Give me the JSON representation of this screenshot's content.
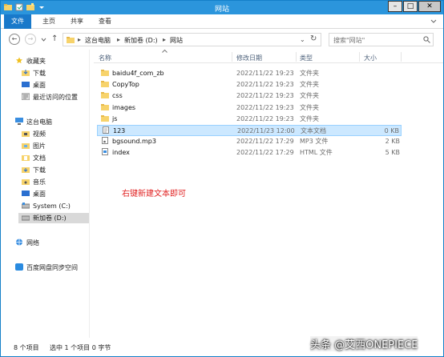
{
  "window": {
    "title": "网站",
    "minimize": "–",
    "maximize": "□",
    "close": "✕"
  },
  "ribbon": {
    "tabs": [
      "文件",
      "主页",
      "共享",
      "查看"
    ]
  },
  "address": {
    "crumbs": [
      "这台电脑",
      "新加卷 (D:)",
      "网站"
    ],
    "search_placeholder": "搜索\"网站\""
  },
  "nav": {
    "favorites": "收藏夹",
    "fav_items": [
      "下载",
      "桌面",
      "最近访问的位置"
    ],
    "this_pc": "这台电脑",
    "pc_items": [
      "视频",
      "图片",
      "文档",
      "下载",
      "音乐",
      "桌面",
      "System (C:)",
      "新加卷 (D:)"
    ],
    "network": "网络",
    "baidu": "百度网盘同步空间"
  },
  "columns": {
    "name": "名称",
    "date": "修改日期",
    "type": "类型",
    "size": "大小"
  },
  "files": [
    {
      "name": "baidu4f_com_zb",
      "date": "2022/11/22 19:23",
      "type": "文件夹",
      "size": "",
      "icon": "folder-icon"
    },
    {
      "name": "CopyTop",
      "date": "2022/11/22 19:23",
      "type": "文件夹",
      "size": "",
      "icon": "folder-icon"
    },
    {
      "name": "css",
      "date": "2022/11/22 19:23",
      "type": "文件夹",
      "size": "",
      "icon": "folder-icon"
    },
    {
      "name": "images",
      "date": "2022/11/22 19:23",
      "type": "文件夹",
      "size": "",
      "icon": "folder-icon"
    },
    {
      "name": "js",
      "date": "2022/11/22 19:23",
      "type": "文件夹",
      "size": "",
      "icon": "folder-icon"
    },
    {
      "name": "123",
      "date": "2022/11/23 12:00",
      "type": "文本文档",
      "size": "0 KB",
      "icon": "text-file-icon",
      "selected": true
    },
    {
      "name": "bgsound.mp3",
      "date": "2022/11/22 17:29",
      "type": "MP3 文件",
      "size": "2 KB",
      "icon": "audio-file-icon"
    },
    {
      "name": "index",
      "date": "2022/11/22 17:29",
      "type": "HTML 文件",
      "size": "5 KB",
      "icon": "html-file-icon"
    }
  ],
  "annotation": "右键新建文本即可",
  "status": {
    "count": "8 个项目",
    "selected": "选中 1 个项目 0 字节"
  },
  "watermark": "头条 @艾西ONEPIECE"
}
